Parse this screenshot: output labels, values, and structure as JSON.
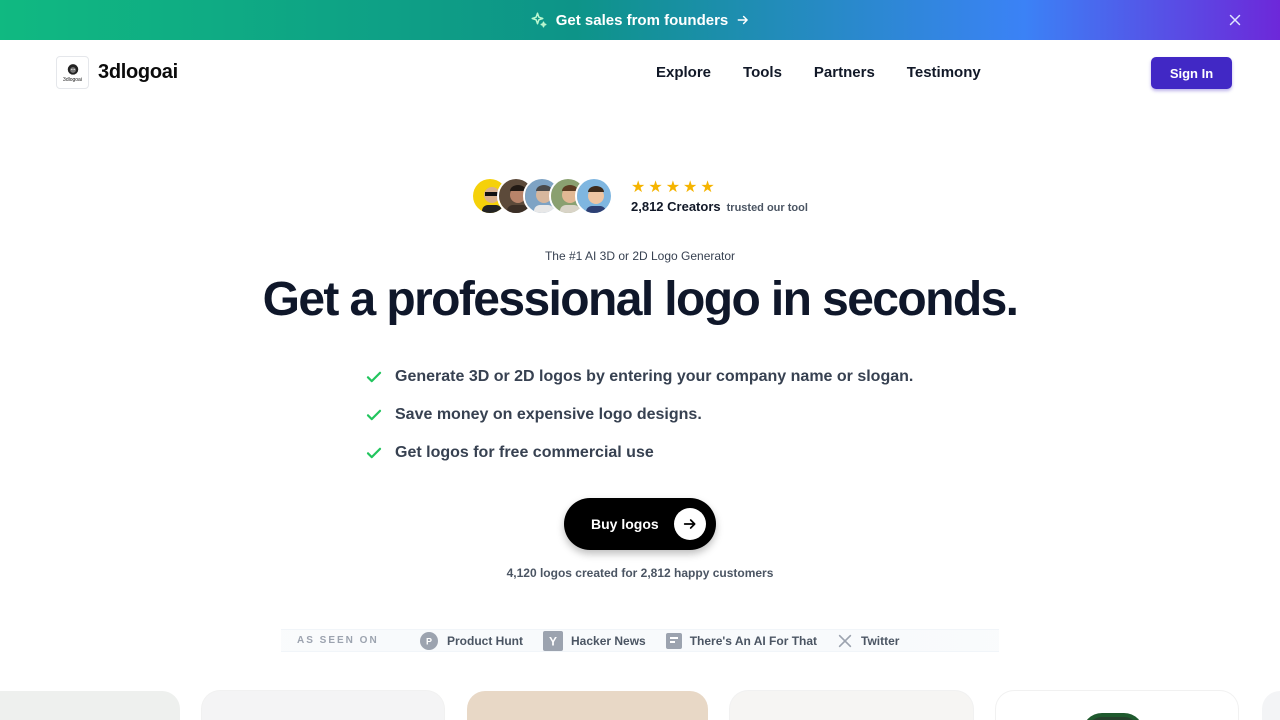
{
  "banner": {
    "label": "Get sales from founders",
    "sparkle_icon": "sparkle-icon",
    "arrow_icon": "arrow-right-icon",
    "close_icon": "close-icon"
  },
  "brand": {
    "name": "3dlogoai",
    "mark_text": "3dlogoai"
  },
  "nav": {
    "links": [
      "Explore",
      "Tools",
      "Partners",
      "Testimony"
    ],
    "signin_label": "Sign In"
  },
  "social_proof": {
    "count": "2,812 Creators",
    "suffix": "trusted our tool",
    "stars": 5
  },
  "hero": {
    "eyebrow": "The #1 AI 3D or 2D Logo Generator",
    "headline": "Get a professional logo in seconds.",
    "features": [
      "Generate 3D or 2D logos by entering your company name or slogan.",
      "Save money on expensive logo designs.",
      "Get logos for free commercial use"
    ],
    "cta_label": "Buy logos",
    "stats": "4,120 logos created for 2,812 happy customers"
  },
  "as_seen_on": {
    "label": "AS SEEN ON",
    "sources": [
      "Product Hunt",
      "Hacker News",
      "There's An AI For That",
      "Twitter"
    ]
  },
  "colors": {
    "accent": "#4128c5",
    "check": "#22c55e",
    "star": "#f5b400"
  }
}
